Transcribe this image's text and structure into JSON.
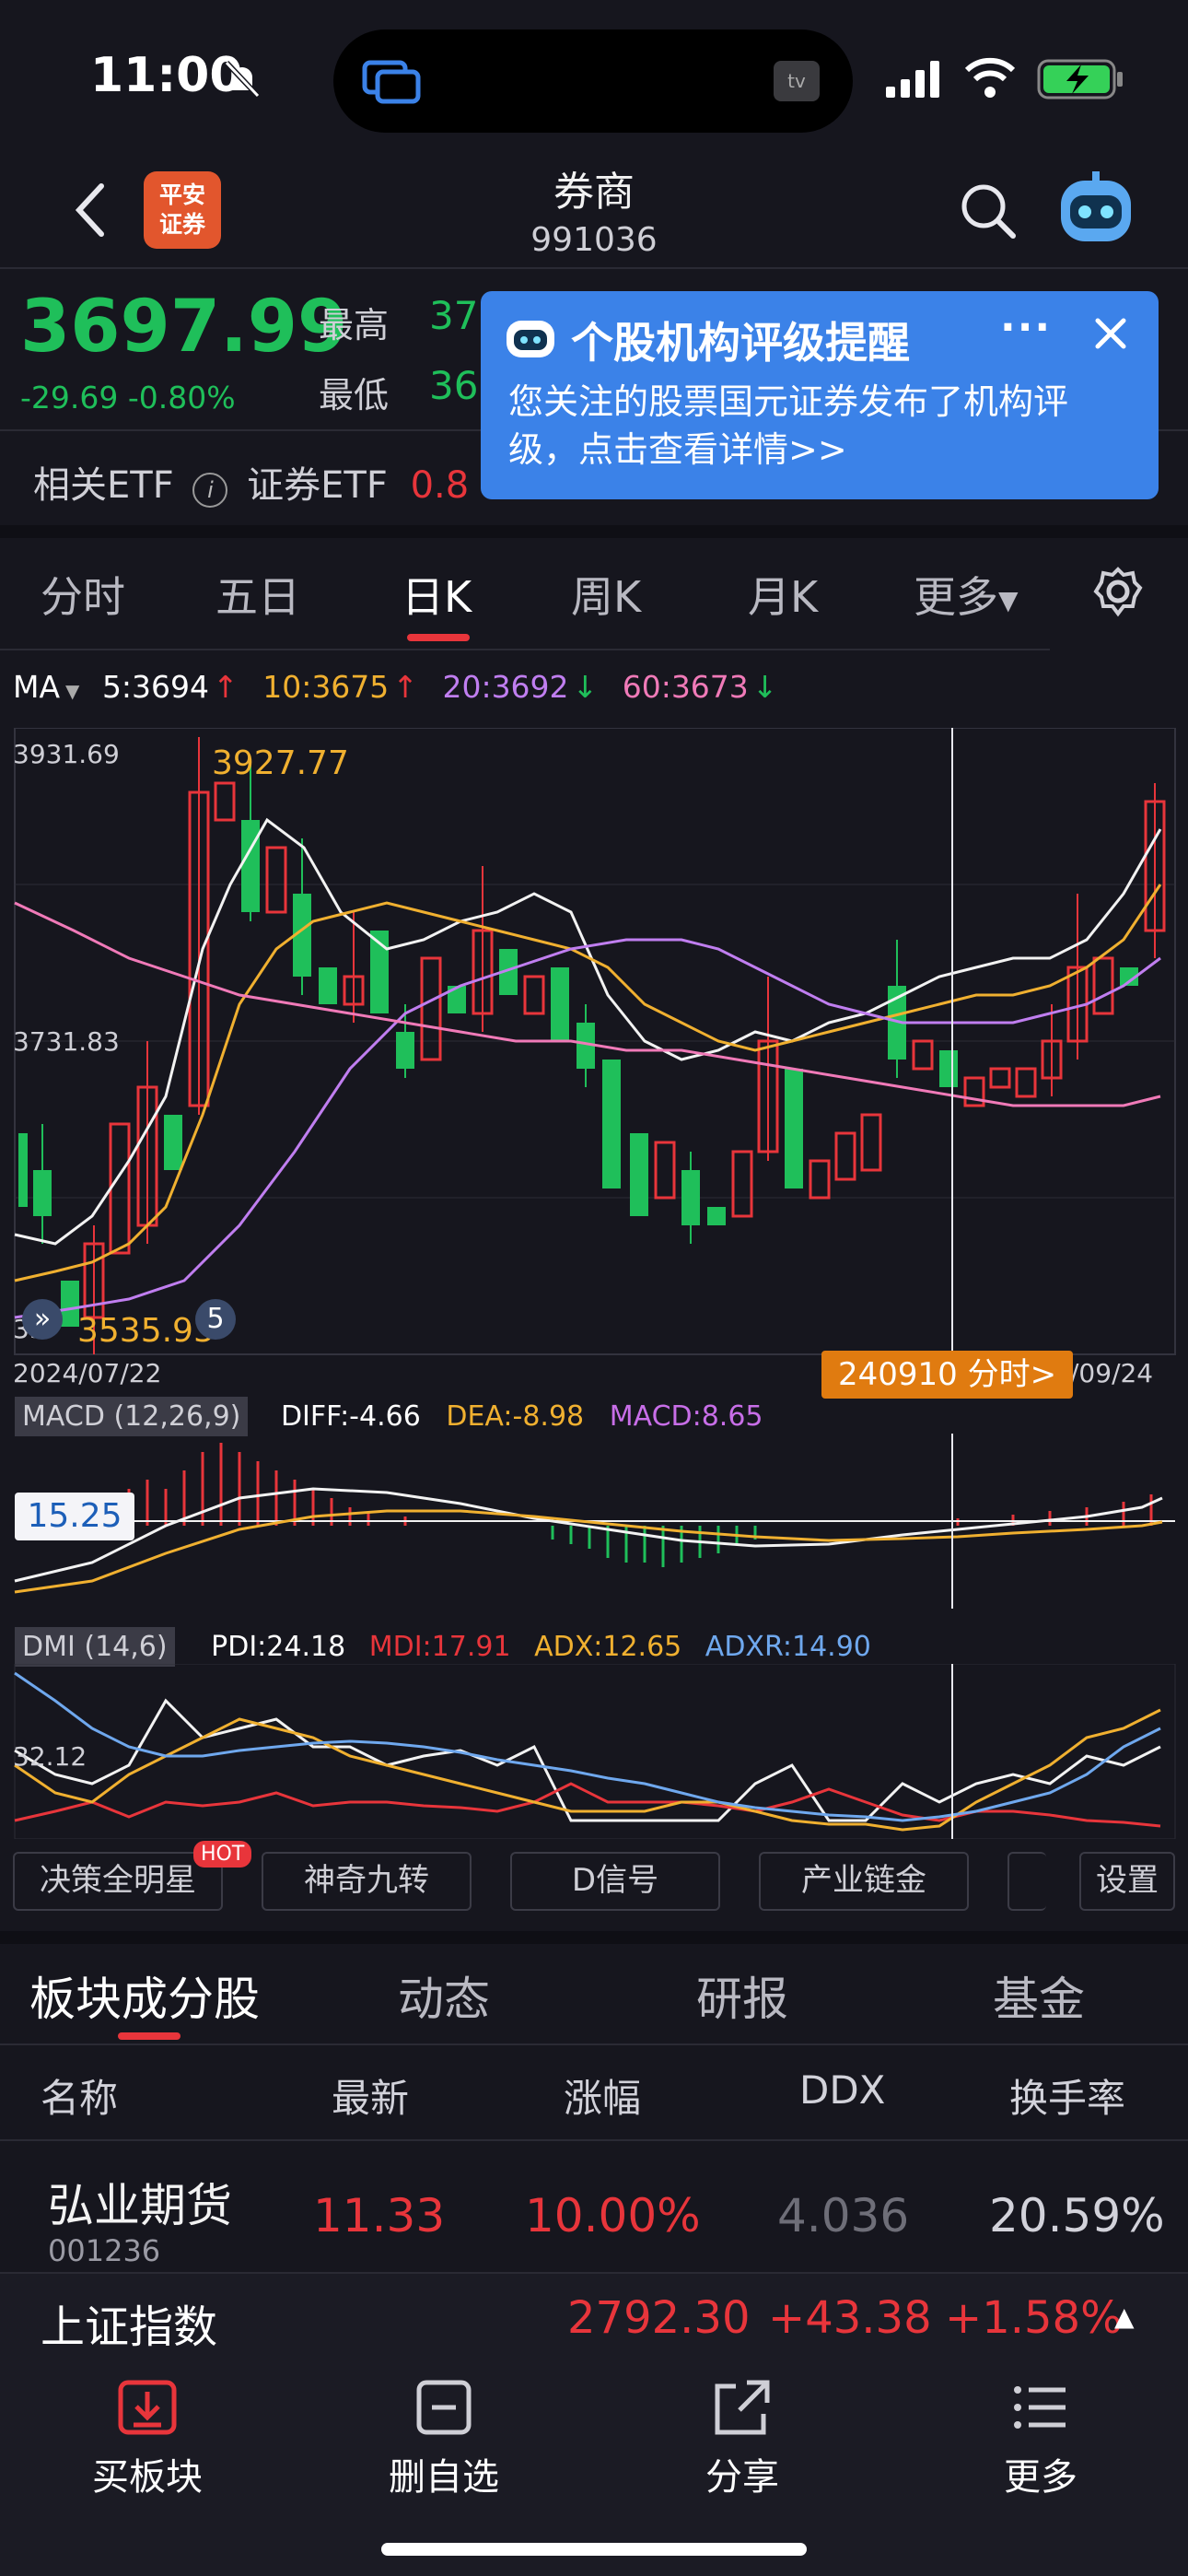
{
  "status": {
    "time": "11:00",
    "tv": "tv"
  },
  "header": {
    "title": "券商",
    "code": "991036",
    "logo_line1": "平安",
    "logo_line2": "证券"
  },
  "quote": {
    "price": "3697.99",
    "change": "-29.69 -0.80%",
    "high_label": "最高",
    "high_value": "37",
    "low_label": "最低",
    "low_value": "36",
    "etf_label": "相关ETF",
    "etf_name": "证券ETF",
    "etf_value": "0.8"
  },
  "popup": {
    "title": "个股机构评级提醒",
    "message": "您关注的股票国元证券发布了机构评级，点击查看详情>>"
  },
  "period_tabs": [
    "分时",
    "五日",
    "日K",
    "周K",
    "月K",
    "更多"
  ],
  "ma": {
    "label": "MA",
    "ma5": "5:3694",
    "ma10": "10:3675",
    "ma20": "20:3692",
    "ma60": "60:3673"
  },
  "kline": {
    "y_top": "3931.69",
    "y_mid": "3731.83",
    "y_bottom": "35",
    "max_label": "3927.77",
    "min_label": "3535.93",
    "date_start": "2024/07/22",
    "date_end": "/09/24",
    "cursor_label": "240910 分时>",
    "marker_5": "5"
  },
  "macd": {
    "label": "MACD (12,26,9)",
    "diff": "DIFF:-4.66",
    "dea": "DEA:-8.98",
    "macd": "MACD:8.65",
    "cursor_value": "15.25"
  },
  "dmi": {
    "label": "DMI (14,6)",
    "pdi": "PDI:24.18",
    "mdi": "MDI:17.91",
    "adx": "ADX:12.65",
    "adxr": "ADXR:14.90",
    "level": "32.12"
  },
  "tools": [
    "决策全明星",
    "神奇九转",
    "D信号",
    "产业链金",
    "设置"
  ],
  "hot_badge": "HOT",
  "section_tabs": [
    "板块成分股",
    "动态",
    "研报",
    "基金"
  ],
  "table": {
    "headers": [
      "名称",
      "最新",
      "涨幅",
      "DDX",
      "换手率"
    ],
    "rows": [
      {
        "name": "弘业期货",
        "code": "001236",
        "latest": "11.33",
        "change": "10.00%",
        "ddx": "4.036",
        "turnover": "20.59%"
      }
    ]
  },
  "index_ticker": {
    "name": "上证指数",
    "value": "2792.30",
    "change": "+43.38",
    "pct": "+1.58%"
  },
  "bottom_nav": [
    "买板块",
    "删自选",
    "分享",
    "更多"
  ],
  "colors": {
    "up": "#e8353b",
    "down": "#1fbf5a",
    "accent": "#3b82e8",
    "orange": "#f0a020"
  }
}
